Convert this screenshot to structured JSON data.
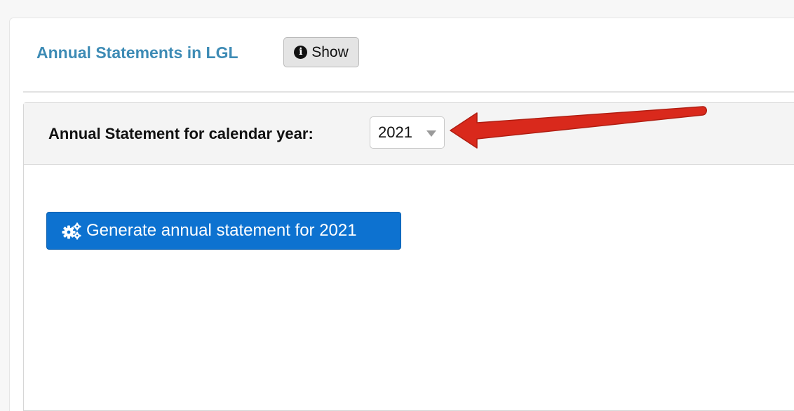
{
  "header": {
    "title": "Annual Statements in LGL",
    "show_button": {
      "label": "Show",
      "icon": "info-circle-icon"
    }
  },
  "panel": {
    "year_label": "Annual Statement for calendar year:",
    "year_select": {
      "value": "2021",
      "options_visible": [
        "2021"
      ]
    },
    "generate_button": {
      "label": "Generate annual statement for 2021",
      "icon": "cogs-icon"
    }
  },
  "annotation": {
    "type": "arrow",
    "color": "#d9291c",
    "points_to": "year-select"
  },
  "colors": {
    "title": "#3d8bb5",
    "primary_button": "#0d72d0",
    "panel_header_bg": "#f4f4f4"
  }
}
